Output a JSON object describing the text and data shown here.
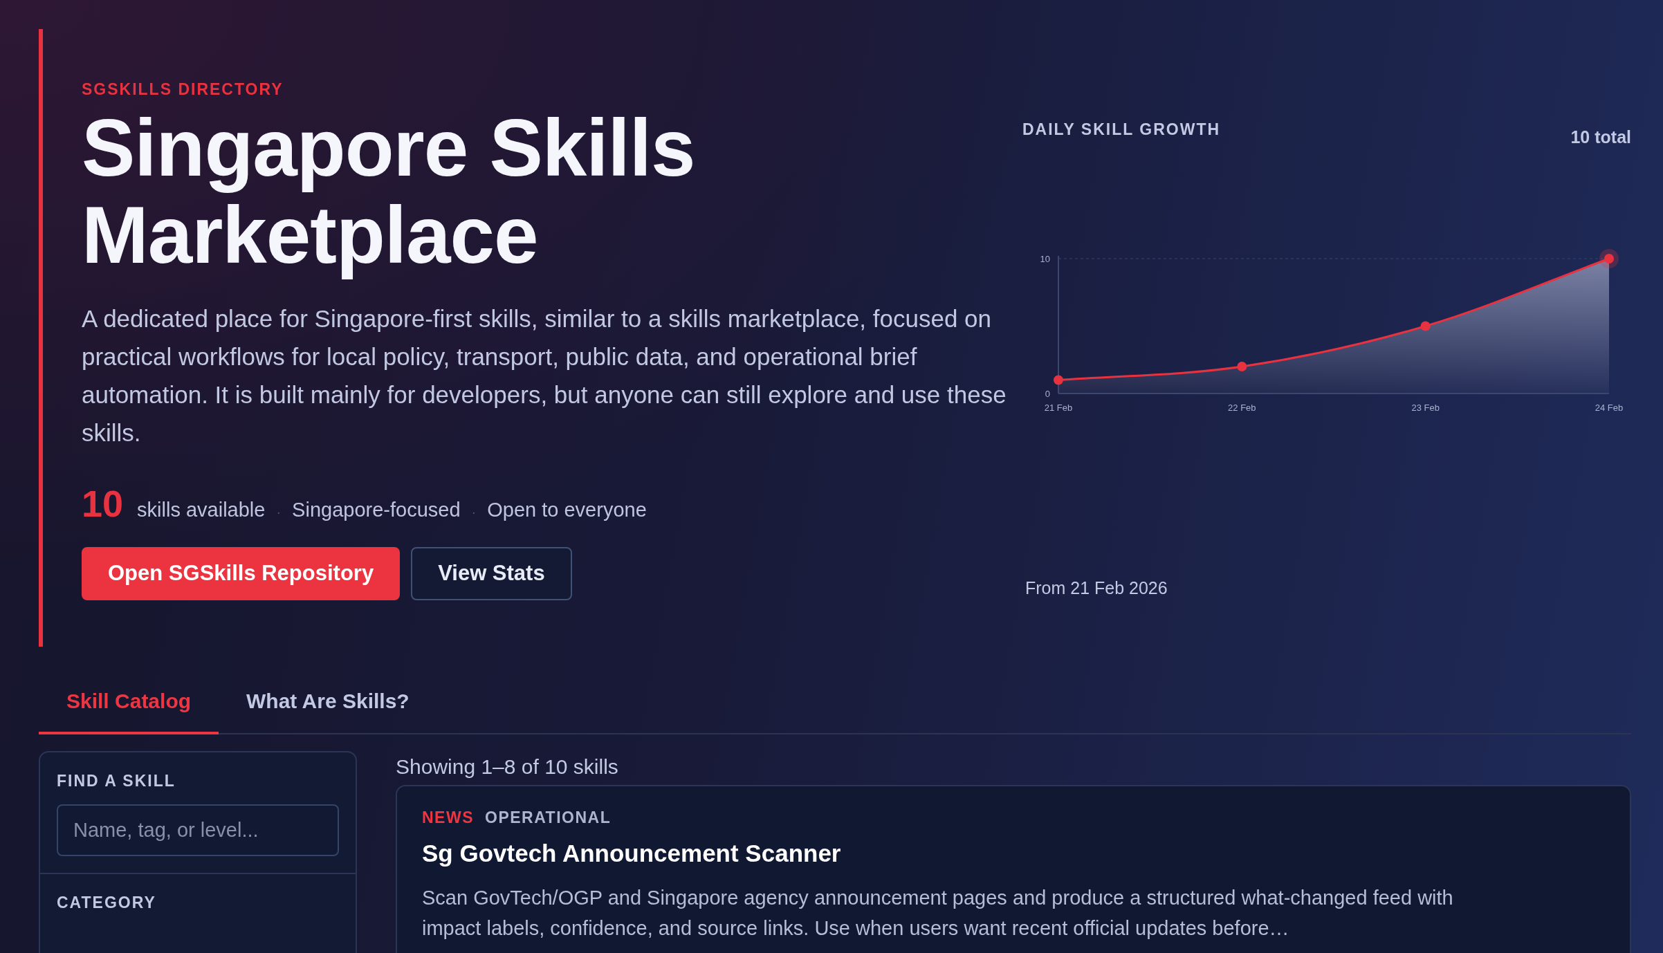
{
  "hero": {
    "eyebrow": "SGSKILLS DIRECTORY",
    "title_lines": [
      "Singapore Skills",
      "Marketplace"
    ],
    "description": "A dedicated place for Singapore-first skills, similar to a skills marketplace, focused on practical workflows for local policy, transport, public data, and operational brief automation. It is built mainly for developers, but anyone can still explore and use these skills.",
    "stats": {
      "count": "10",
      "items": [
        {
          "kind": "text",
          "text": "skills available"
        },
        {
          "kind": "separator",
          "text": "·"
        },
        {
          "kind": "text",
          "text": "Singapore-focused"
        },
        {
          "kind": "separator",
          "text": "·"
        },
        {
          "kind": "text",
          "text": "Open to everyone"
        }
      ]
    },
    "buttons": [
      {
        "kind": "primary",
        "label": "Open SGSkills Repository"
      },
      {
        "kind": "outline",
        "label": "View Stats"
      }
    ]
  },
  "growth_panel": {
    "title": "DAILY SKILL GROWTH",
    "total": "10 total",
    "footer": "From 21 Feb 2026",
    "chart_data": {
      "type": "area",
      "categories": [
        "21 Feb",
        "22 Feb",
        "23 Feb",
        "24 Feb"
      ],
      "series": [
        {
          "color": "#e8323f",
          "values": [
            1,
            2,
            5,
            10
          ]
        }
      ],
      "ylim": [
        0,
        10
      ],
      "yticks": [
        0,
        10
      ]
    }
  },
  "tabs": [
    {
      "label": "Skill Catalog",
      "selected": true
    },
    {
      "label": "What Are Skills?",
      "selected": false
    }
  ],
  "filters": {
    "search_label": "FIND A SKILL",
    "search": {
      "placeholder": "Name, tag, or level..."
    },
    "category_label": "CATEGORY"
  },
  "results": {
    "summary": "Showing 1–8 of 10 skills",
    "skills": [
      {
        "category": "NEWS",
        "level": "OPERATIONAL",
        "title": "Sg Govtech Announcement Scanner",
        "description": "Scan GovTech/OGP and Singapore agency announcement pages and produce a structured what-changed feed with impact labels, confidence, and source links. Use when users want recent official updates before…"
      }
    ]
  }
}
